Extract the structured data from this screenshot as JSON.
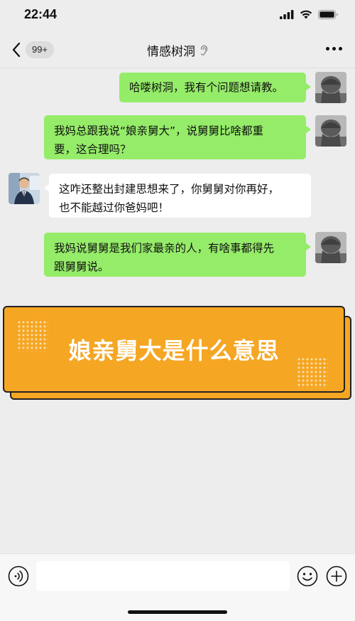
{
  "status_bar": {
    "time": "22:44"
  },
  "nav": {
    "unread_badge": "99+",
    "title": "情感树洞",
    "title_icon": "ear-icon"
  },
  "messages": [
    {
      "side": "right",
      "text": "哈喽树洞，我有个问题想请教。"
    },
    {
      "side": "right",
      "line1": "我妈总跟我说“娘亲舅大”，说舅舅比啥都重",
      "line2": "要，这合理吗？"
    },
    {
      "side": "left",
      "line1": "这咋还整出封建思想来了，你舅舅对你再好，",
      "line2": "也不能越过你爸妈吧！"
    },
    {
      "side": "right",
      "line1": "我妈说舅舅是我们家最亲的人，有啥事都得先",
      "line2": "跟舅舅说。"
    }
  ],
  "banner": {
    "title": "娘亲舅大是什么意思",
    "color": "#f5a623"
  },
  "input_bar": {
    "placeholder": "",
    "icons": [
      "voice-icon",
      "emoji-icon",
      "plus-icon"
    ]
  },
  "colors": {
    "bubble_self": "#95ec69",
    "bubble_other": "#ffffff",
    "background": "#ededed"
  }
}
